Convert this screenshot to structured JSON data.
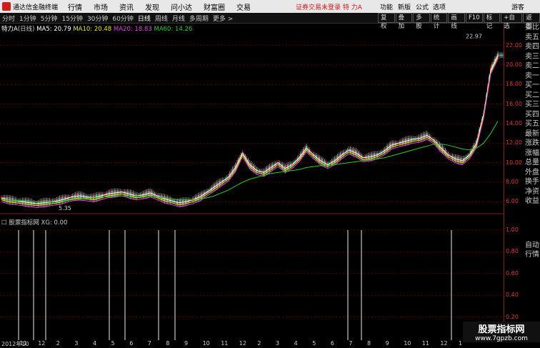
{
  "menu": {
    "app_title": "通达信金融终端",
    "items": [
      "行情",
      "市场",
      "资讯",
      "发现",
      "问小达",
      "财富圈",
      "交易"
    ],
    "alert": "证券交易未登录",
    "stock": "特 力A",
    "right": [
      "功能",
      "新版",
      "公式",
      "选项",
      "游客"
    ]
  },
  "toolbar": {
    "periods": [
      "分时",
      "1分钟",
      "5分钟",
      "15分钟",
      "30分钟",
      "60分钟",
      "日线",
      "周线",
      "月线",
      "多周期",
      "更多 >"
    ],
    "active": "日线",
    "tools": [
      "复权",
      "叠加",
      "多股",
      "统计",
      "画线",
      "F10",
      "标记",
      "+自选",
      "返回"
    ]
  },
  "chart_title": {
    "name": "特力A",
    "period": "(日线)",
    "ma5": "MA5: 20.79",
    "ma10": "MA10: 20.48",
    "ma20": "MA20: 18.83",
    "ma60": "MA60: 14.26"
  },
  "colors": {
    "ma5": "#ffffff",
    "ma10": "#e8e800",
    "ma20": "#e040e0",
    "ma60": "#20d020",
    "up": "#e02020",
    "down": "#20c0c0"
  },
  "price_axis": [
    "22.00",
    "20.00",
    "18.00",
    "16.00",
    "14.00",
    "12.00",
    "10.00",
    "8.00",
    "6.00"
  ],
  "annotations": {
    "high": "22.97",
    "low": "5.35"
  },
  "right_panel": [
    "委比",
    "卖五",
    "卖四",
    "卖三",
    "卖二",
    "卖一",
    "买一",
    "买二",
    "买三",
    "买四",
    "买五",
    "最新",
    "涨跌",
    "涨幅",
    "总量",
    "外盘",
    "换手",
    "净资",
    "收益"
  ],
  "right_panel_bottom": [
    "自动",
    "行情"
  ],
  "indicator": {
    "name": "股票指标网",
    "value": "XG: 0.00",
    "axis": [
      "1.00",
      "0.80",
      "0.60",
      "0.40",
      "0.20"
    ]
  },
  "x_labels": [
    "2012年10",
    "11",
    "12",
    "2",
    "3",
    "4",
    "5",
    "6",
    "7",
    "8",
    "9",
    "10",
    "11",
    "12",
    "2",
    "3",
    "4",
    "5",
    "6",
    "7",
    "8",
    "9",
    "10",
    "11",
    "12",
    "1"
  ],
  "watermark": {
    "title": "股票指标网",
    "url": "www.7gpzb.com"
  },
  "chart_data": {
    "type": "line",
    "ylim": [
      5,
      23
    ],
    "x": [
      0,
      10,
      20,
      30,
      40,
      50,
      60,
      70,
      80,
      90,
      100,
      110,
      120,
      130,
      140,
      150,
      160,
      170,
      180,
      190,
      200,
      210,
      220,
      230,
      240,
      250,
      260,
      270,
      280,
      290,
      300,
      310,
      320,
      330,
      340,
      350,
      360,
      370,
      380,
      390,
      400,
      410,
      420,
      430,
      440,
      450,
      460,
      470,
      480,
      490,
      500,
      510,
      520,
      530,
      540,
      550,
      560,
      570,
      580,
      590,
      600,
      610,
      620,
      630,
      640,
      650,
      660,
      670,
      680,
      690,
      700
    ],
    "series": [
      {
        "name": "price",
        "values": [
          6.4,
          6.2,
          6.1,
          6.0,
          5.9,
          5.8,
          5.9,
          6.0,
          6.1,
          6.3,
          6.5,
          6.6,
          6.5,
          6.4,
          6.6,
          6.8,
          6.9,
          7.0,
          6.8,
          6.6,
          6.7,
          6.9,
          6.6,
          6.3,
          6.1,
          5.9,
          6.0,
          6.2,
          6.5,
          7.0,
          7.5,
          8.0,
          8.5,
          9.5,
          11.0,
          9.8,
          9.2,
          9.0,
          9.5,
          10.0,
          9.4,
          9.8,
          10.5,
          11.5,
          10.8,
          10.2,
          9.8,
          10.2,
          10.8,
          11.3,
          11.0,
          10.5,
          10.6,
          10.8,
          11.2,
          11.8,
          12.0,
          12.2,
          12.4,
          12.5,
          12.8,
          12.3,
          11.5,
          10.8,
          10.4,
          10.2,
          10.8,
          12.0,
          15.0,
          19.5,
          21.0
        ]
      },
      {
        "name": "MA60",
        "values": [
          6.3,
          6.2,
          6.1,
          6.1,
          6.0,
          6.0,
          6.0,
          6.0,
          6.0,
          6.1,
          6.2,
          6.3,
          6.4,
          6.4,
          6.5,
          6.5,
          6.6,
          6.6,
          6.6,
          6.6,
          6.6,
          6.6,
          6.5,
          6.4,
          6.3,
          6.2,
          6.2,
          6.2,
          6.3,
          6.4,
          6.6,
          6.9,
          7.2,
          7.6,
          8.0,
          8.3,
          8.5,
          8.7,
          8.9,
          9.0,
          9.1,
          9.2,
          9.3,
          9.5,
          9.6,
          9.7,
          9.7,
          9.8,
          9.9,
          10.0,
          10.1,
          10.2,
          10.3,
          10.4,
          10.5,
          10.7,
          10.9,
          11.1,
          11.3,
          11.5,
          11.7,
          11.9,
          11.9,
          11.8,
          11.6,
          11.4,
          11.3,
          11.5,
          12.0,
          13.0,
          14.26
        ]
      }
    ],
    "indicator_signals": [
      26,
      47,
      64,
      153,
      175,
      222,
      245,
      487,
      506,
      632
    ]
  }
}
